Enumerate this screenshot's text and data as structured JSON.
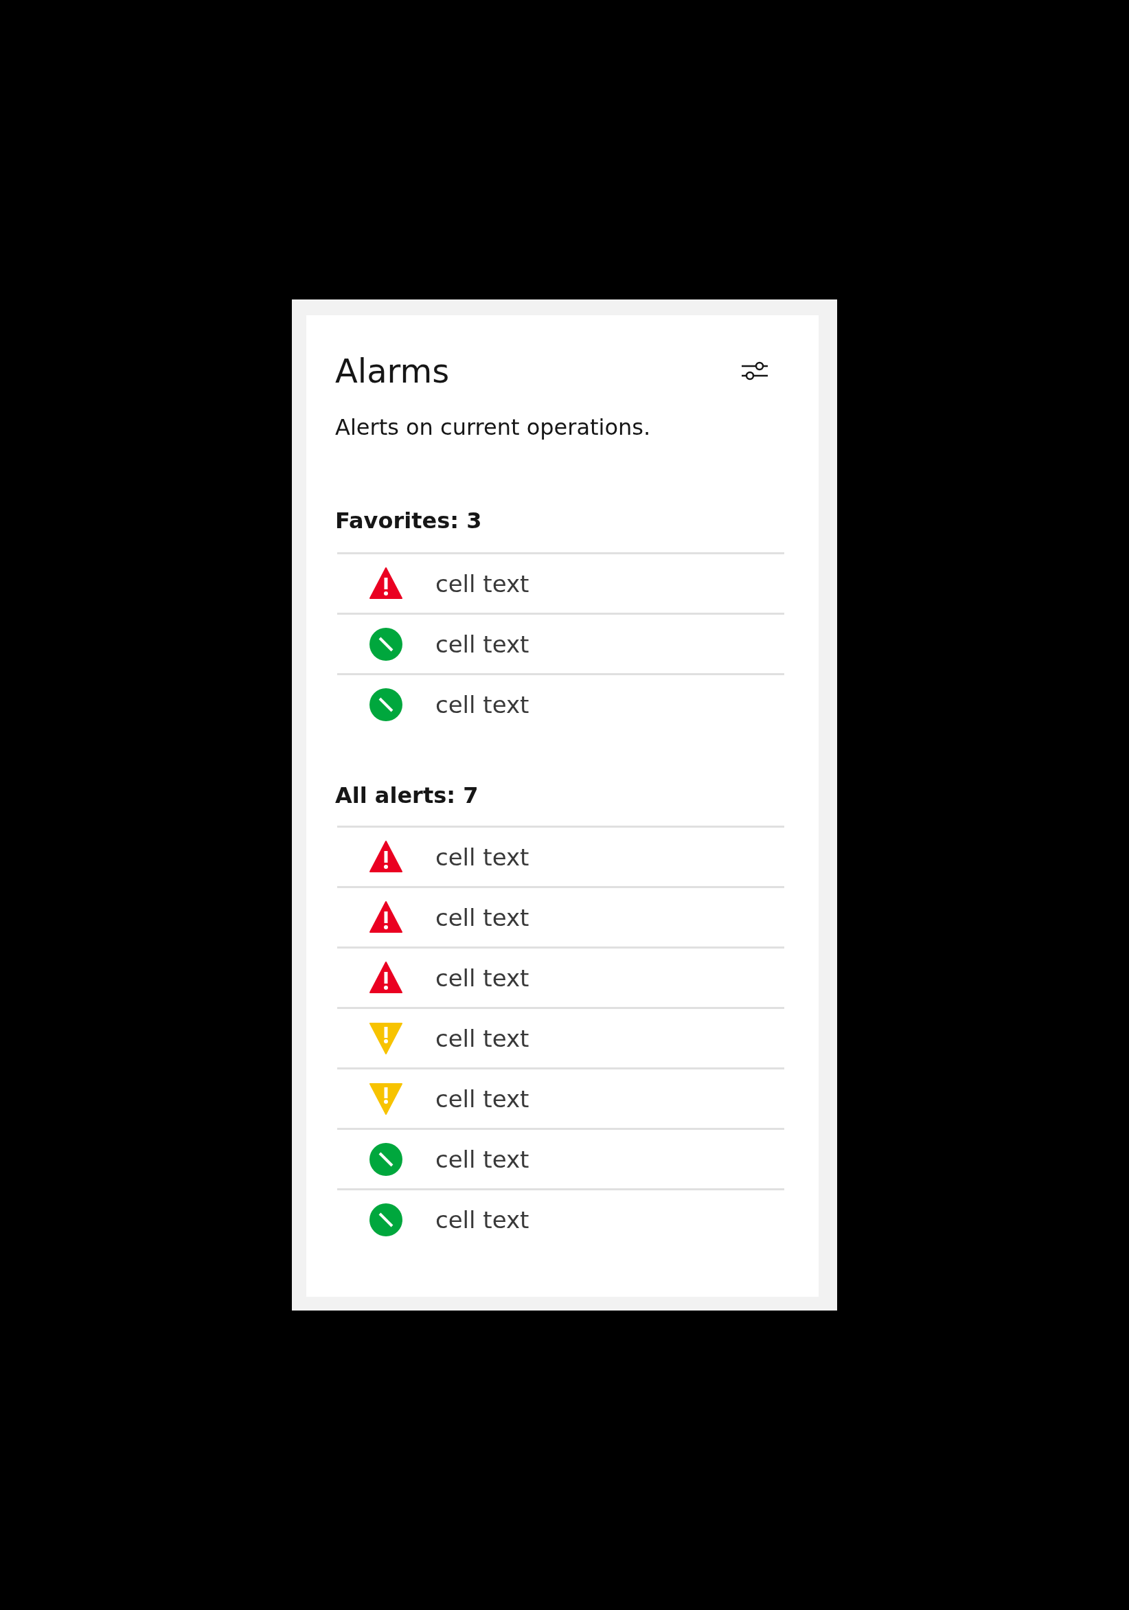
{
  "card": {
    "title": "Alarms",
    "description": "Alerts on current operations."
  },
  "sections": [
    {
      "heading": "Favorites: 3",
      "rows": [
        {
          "kind": "critical",
          "text": "cell text"
        },
        {
          "kind": "normal",
          "text": "cell text"
        },
        {
          "kind": "normal",
          "text": "cell text"
        }
      ]
    },
    {
      "heading": "All alerts: 7",
      "rows": [
        {
          "kind": "critical",
          "text": "cell text"
        },
        {
          "kind": "critical",
          "text": "cell text"
        },
        {
          "kind": "critical",
          "text": "cell text"
        },
        {
          "kind": "warning",
          "text": "cell text"
        },
        {
          "kind": "warning",
          "text": "cell text"
        },
        {
          "kind": "normal",
          "text": "cell text"
        },
        {
          "kind": "normal",
          "text": "cell text"
        }
      ]
    }
  ]
}
